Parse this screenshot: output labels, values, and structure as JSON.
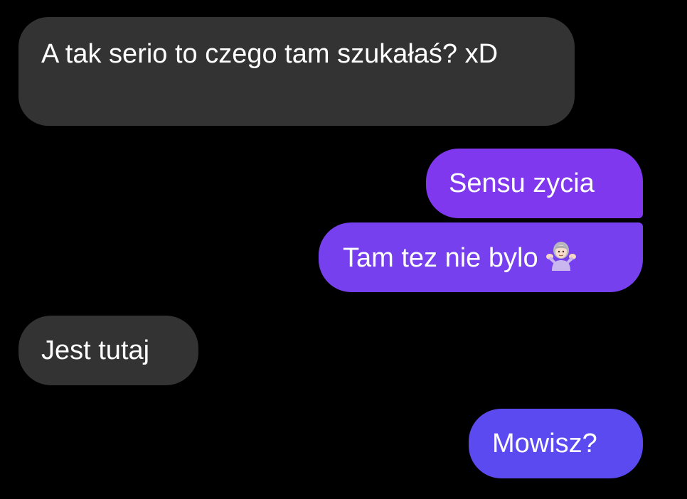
{
  "messages": [
    {
      "direction": "incoming",
      "text": "A tak serio to czego tam szukałaś? xD"
    },
    {
      "direction": "outgoing",
      "text": "Sensu zycia"
    },
    {
      "direction": "outgoing",
      "text": "Tam tez nie bylo",
      "emoji": "person-shrugging-emoji"
    },
    {
      "direction": "incoming",
      "text": "Jest tutaj"
    },
    {
      "direction": "outgoing",
      "text": "Mowisz?"
    }
  ],
  "colors": {
    "background": "#000000",
    "incoming_bubble": "#333333",
    "outgoing_bubble_top": "#7f38ee",
    "outgoing_bubble_bottom": "#5a4af0",
    "text": "#ffffff"
  }
}
